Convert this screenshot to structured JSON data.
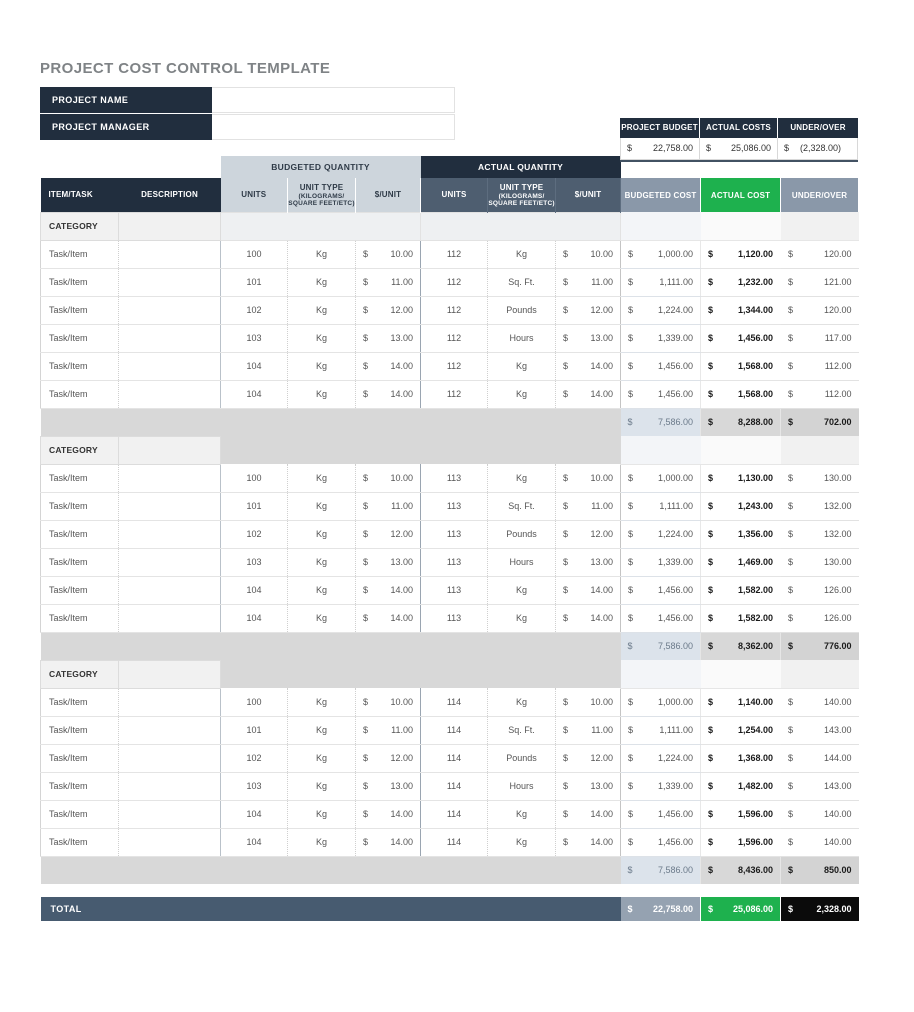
{
  "title": "PROJECT COST CONTROL TEMPLATE",
  "project_fields": [
    {
      "label": "PROJECT NAME",
      "value": ""
    },
    {
      "label": "PROJECT MANAGER",
      "value": ""
    }
  ],
  "summary": {
    "columns": [
      "PROJECT BUDGET",
      "ACTUAL COSTS",
      "UNDER/OVER"
    ],
    "currency": "$",
    "values": [
      "22,758.00",
      "25,086.00",
      "(2,328.00)"
    ]
  },
  "table": {
    "currency": "$",
    "group_headers": {
      "budgeted": "BUDGETED QUANTITY",
      "actual": "ACTUAL QUANTITY"
    },
    "columns": {
      "item_task": "ITEM/TASK",
      "description": "DESCRIPTION",
      "units": "UNITS",
      "unit_type": "UNIT TYPE",
      "unit_type_note": "(KILOGRAMS/ SQUARE FEET/ETC)",
      "unit_cost": "$/UNIT",
      "budgeted_cost": "BUDGETED COST",
      "actual_cost": "ACTUAL COST",
      "under_over": "UNDER/OVER"
    },
    "sections": [
      {
        "category_label": "CATEGORY",
        "rows": [
          {
            "item": "Task/Item",
            "description": "",
            "b_units": "100",
            "b_type": "Kg",
            "b_rate": "10.00",
            "a_units": "112",
            "a_type": "Kg",
            "a_rate": "10.00",
            "b_cost": "1,000.00",
            "a_cost": "1,120.00",
            "uo": "120.00"
          },
          {
            "item": "Task/Item",
            "description": "",
            "b_units": "101",
            "b_type": "Kg",
            "b_rate": "11.00",
            "a_units": "112",
            "a_type": "Sq. Ft.",
            "a_rate": "11.00",
            "b_cost": "1,111.00",
            "a_cost": "1,232.00",
            "uo": "121.00"
          },
          {
            "item": "Task/Item",
            "description": "",
            "b_units": "102",
            "b_type": "Kg",
            "b_rate": "12.00",
            "a_units": "112",
            "a_type": "Pounds",
            "a_rate": "12.00",
            "b_cost": "1,224.00",
            "a_cost": "1,344.00",
            "uo": "120.00"
          },
          {
            "item": "Task/Item",
            "description": "",
            "b_units": "103",
            "b_type": "Kg",
            "b_rate": "13.00",
            "a_units": "112",
            "a_type": "Hours",
            "a_rate": "13.00",
            "b_cost": "1,339.00",
            "a_cost": "1,456.00",
            "uo": "117.00"
          },
          {
            "item": "Task/Item",
            "description": "",
            "b_units": "104",
            "b_type": "Kg",
            "b_rate": "14.00",
            "a_units": "112",
            "a_type": "Kg",
            "a_rate": "14.00",
            "b_cost": "1,456.00",
            "a_cost": "1,568.00",
            "uo": "112.00"
          },
          {
            "item": "Task/Item",
            "description": "",
            "b_units": "104",
            "b_type": "Kg",
            "b_rate": "14.00",
            "a_units": "112",
            "a_type": "Kg",
            "a_rate": "14.00",
            "b_cost": "1,456.00",
            "a_cost": "1,568.00",
            "uo": "112.00"
          }
        ],
        "subtotal": {
          "b_cost": "7,586.00",
          "a_cost": "8,288.00",
          "uo": "702.00"
        }
      },
      {
        "category_label": "CATEGORY",
        "rows": [
          {
            "item": "Task/Item",
            "description": "",
            "b_units": "100",
            "b_type": "Kg",
            "b_rate": "10.00",
            "a_units": "113",
            "a_type": "Kg",
            "a_rate": "10.00",
            "b_cost": "1,000.00",
            "a_cost": "1,130.00",
            "uo": "130.00"
          },
          {
            "item": "Task/Item",
            "description": "",
            "b_units": "101",
            "b_type": "Kg",
            "b_rate": "11.00",
            "a_units": "113",
            "a_type": "Sq. Ft.",
            "a_rate": "11.00",
            "b_cost": "1,111.00",
            "a_cost": "1,243.00",
            "uo": "132.00"
          },
          {
            "item": "Task/Item",
            "description": "",
            "b_units": "102",
            "b_type": "Kg",
            "b_rate": "12.00",
            "a_units": "113",
            "a_type": "Pounds",
            "a_rate": "12.00",
            "b_cost": "1,224.00",
            "a_cost": "1,356.00",
            "uo": "132.00"
          },
          {
            "item": "Task/Item",
            "description": "",
            "b_units": "103",
            "b_type": "Kg",
            "b_rate": "13.00",
            "a_units": "113",
            "a_type": "Hours",
            "a_rate": "13.00",
            "b_cost": "1,339.00",
            "a_cost": "1,469.00",
            "uo": "130.00"
          },
          {
            "item": "Task/Item",
            "description": "",
            "b_units": "104",
            "b_type": "Kg",
            "b_rate": "14.00",
            "a_units": "113",
            "a_type": "Kg",
            "a_rate": "14.00",
            "b_cost": "1,456.00",
            "a_cost": "1,582.00",
            "uo": "126.00"
          },
          {
            "item": "Task/Item",
            "description": "",
            "b_units": "104",
            "b_type": "Kg",
            "b_rate": "14.00",
            "a_units": "113",
            "a_type": "Kg",
            "a_rate": "14.00",
            "b_cost": "1,456.00",
            "a_cost": "1,582.00",
            "uo": "126.00"
          }
        ],
        "subtotal": {
          "b_cost": "7,586.00",
          "a_cost": "8,362.00",
          "uo": "776.00"
        }
      },
      {
        "category_label": "CATEGORY",
        "rows": [
          {
            "item": "Task/Item",
            "description": "",
            "b_units": "100",
            "b_type": "Kg",
            "b_rate": "10.00",
            "a_units": "114",
            "a_type": "Kg",
            "a_rate": "10.00",
            "b_cost": "1,000.00",
            "a_cost": "1,140.00",
            "uo": "140.00"
          },
          {
            "item": "Task/Item",
            "description": "",
            "b_units": "101",
            "b_type": "Kg",
            "b_rate": "11.00",
            "a_units": "114",
            "a_type": "Sq. Ft.",
            "a_rate": "11.00",
            "b_cost": "1,111.00",
            "a_cost": "1,254.00",
            "uo": "143.00"
          },
          {
            "item": "Task/Item",
            "description": "",
            "b_units": "102",
            "b_type": "Kg",
            "b_rate": "12.00",
            "a_units": "114",
            "a_type": "Pounds",
            "a_rate": "12.00",
            "b_cost": "1,224.00",
            "a_cost": "1,368.00",
            "uo": "144.00"
          },
          {
            "item": "Task/Item",
            "description": "",
            "b_units": "103",
            "b_type": "Kg",
            "b_rate": "13.00",
            "a_units": "114",
            "a_type": "Hours",
            "a_rate": "13.00",
            "b_cost": "1,339.00",
            "a_cost": "1,482.00",
            "uo": "143.00"
          },
          {
            "item": "Task/Item",
            "description": "",
            "b_units": "104",
            "b_type": "Kg",
            "b_rate": "14.00",
            "a_units": "114",
            "a_type": "Kg",
            "a_rate": "14.00",
            "b_cost": "1,456.00",
            "a_cost": "1,596.00",
            "uo": "140.00"
          },
          {
            "item": "Task/Item",
            "description": "",
            "b_units": "104",
            "b_type": "Kg",
            "b_rate": "14.00",
            "a_units": "114",
            "a_type": "Kg",
            "a_rate": "14.00",
            "b_cost": "1,456.00",
            "a_cost": "1,596.00",
            "uo": "140.00"
          }
        ],
        "subtotal": {
          "b_cost": "7,586.00",
          "a_cost": "8,436.00",
          "uo": "850.00"
        }
      }
    ],
    "total": {
      "label": "TOTAL",
      "b_cost": "22,758.00",
      "a_cost": "25,086.00",
      "uo": "2,328.00"
    }
  },
  "colors": {
    "navy": "#212e3e",
    "slate": "#4e5e70",
    "steel": "#8a98a9",
    "light_steel": "#cdd5dc",
    "green": "#1eb14e",
    "total_bar": "#475b70",
    "total_budget": "#95a2b1",
    "black_cell": "#0b0b0b",
    "gray_band": "#d8d8d8",
    "category_bg": "#f1f1f1",
    "budget_col": "#e9eef4",
    "uo_col": "#efefef",
    "sub_budget": "#dce3eb"
  }
}
